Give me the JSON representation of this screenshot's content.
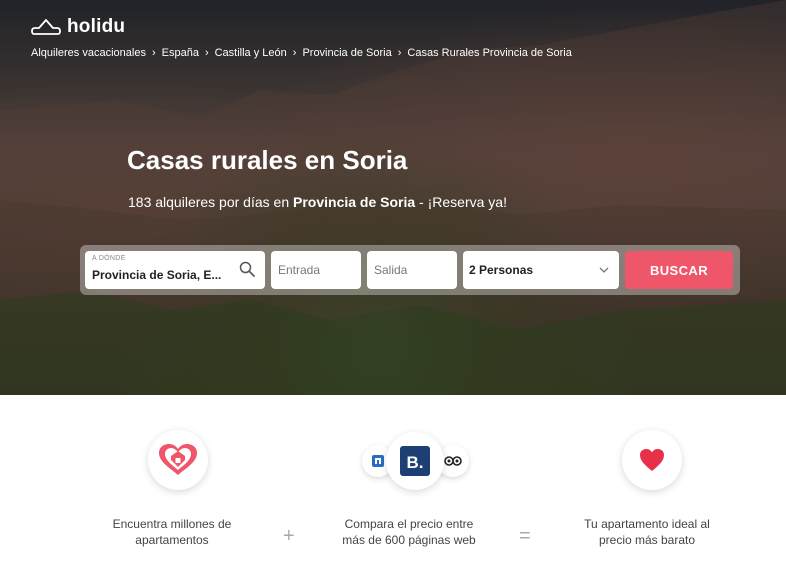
{
  "header": {
    "logo_text": "holidu",
    "logo_icon": "house-cloud-icon"
  },
  "breadcrumb": [
    "Alquileres vacacionales",
    "España",
    "Castilla y León",
    "Provincia de Soria",
    "Casas Rurales Provincia de Soria"
  ],
  "hero": {
    "title": "Casas rurales en Soria",
    "subtitle_prefix": "183 alquileres por días en ",
    "subtitle_bold": "Provincia de Soria",
    "subtitle_suffix": " - ¡Reserva ya!"
  },
  "search": {
    "destination_label": "A DÓNDE",
    "destination_value": "Provincia de Soria, E...",
    "checkin_placeholder": "Entrada",
    "checkout_placeholder": "Salida",
    "guests_value": "2 Personas",
    "button_label": "BUSCAR",
    "accent_color": "#f0566a"
  },
  "features": {
    "items": [
      {
        "text_line1": "Encuentra millones de",
        "text_line2": "apartamentos",
        "icon": "heart-location-icon"
      },
      {
        "text_line1": "Compara el precio entre",
        "text_line2": "más de 600 páginas web",
        "icon": "booking-icon"
      },
      {
        "text_line1": "Tu apartamento ideal al",
        "text_line2": "precio más barato",
        "icon": "heart-icon"
      }
    ],
    "plus": "+",
    "equals": "=",
    "booking_letter": "B"
  }
}
